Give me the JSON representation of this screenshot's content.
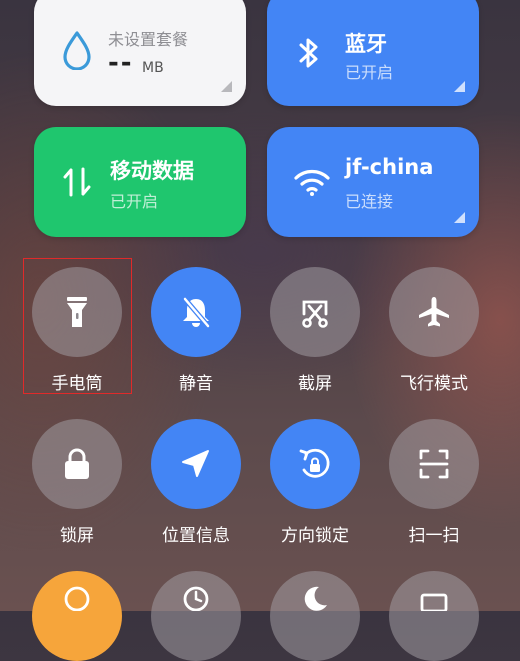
{
  "tiles": {
    "data_plan": {
      "title": "未设置套餐",
      "value": "--",
      "unit": "MB"
    },
    "bluetooth": {
      "title": "蓝牙",
      "status": "已开启"
    },
    "mobile_data": {
      "title": "移动数据",
      "status": "已开启"
    },
    "wifi": {
      "title": "jf-china",
      "status": "已连接"
    }
  },
  "toggles": [
    {
      "label": "手电筒",
      "icon": "flashlight-icon",
      "state": "off"
    },
    {
      "label": "静音",
      "icon": "bell-off-icon",
      "state": "on"
    },
    {
      "label": "截屏",
      "icon": "screenshot-icon",
      "state": "off"
    },
    {
      "label": "飞行模式",
      "icon": "airplane-icon",
      "state": "off"
    },
    {
      "label": "锁屏",
      "icon": "lock-icon",
      "state": "off"
    },
    {
      "label": "位置信息",
      "icon": "location-icon",
      "state": "on"
    },
    {
      "label": "方向锁定",
      "icon": "rotation-lock-icon",
      "state": "on"
    },
    {
      "label": "扫一扫",
      "icon": "scan-icon",
      "state": "off"
    }
  ],
  "colors": {
    "blue": "#4385f5",
    "green": "#1fc66e",
    "white_tile": "#f5f5f7",
    "orange": "#f6a53b",
    "highlight": "#e02a2a"
  }
}
